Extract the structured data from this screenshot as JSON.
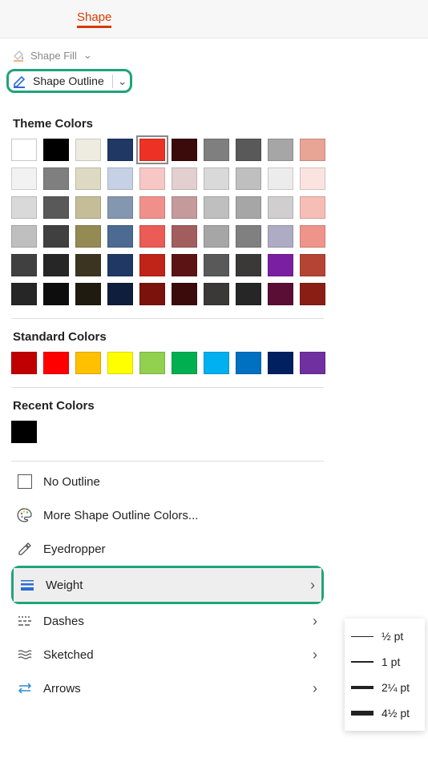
{
  "ribbon": {
    "active_tab": "Shape"
  },
  "toolbar": {
    "shape_fill": "Shape Fill",
    "shape_outline": "Shape Outline"
  },
  "sections": {
    "theme": "Theme Colors",
    "standard": "Standard Colors",
    "recent": "Recent Colors"
  },
  "theme_colors": {
    "row0": [
      "#ffffff",
      "#000000",
      "#eeece1",
      "#1f3864",
      "#ed3225",
      "#3b0a0b",
      "#7f7f7f",
      "#595959",
      "#a6a6a6",
      "#e8a494"
    ],
    "row1": [
      "#f2f2f2",
      "#7f7f7f",
      "#ddd9c3",
      "#c7d1e6",
      "#f6c7c4",
      "#e3cfd0",
      "#d9d9d9",
      "#bfbfbf",
      "#ececec",
      "#fbe3df"
    ],
    "row2": [
      "#d9d9d9",
      "#595959",
      "#c4bd97",
      "#8497b0",
      "#f1908b",
      "#c59a9a",
      "#bfbfbf",
      "#a6a6a6",
      "#d0cece",
      "#f6beb6"
    ],
    "row3": [
      "#bfbfbf",
      "#404040",
      "#948a54",
      "#4c6a92",
      "#ea5c55",
      "#a25e5e",
      "#a6a6a6",
      "#808080",
      "#aeabc4",
      "#ef948b"
    ],
    "row4": [
      "#404040",
      "#262626",
      "#3a3421",
      "#203864",
      "#c02418",
      "#5c1314",
      "#595959",
      "#3b3838",
      "#7b1fa2",
      "#b54434"
    ],
    "row5": [
      "#262626",
      "#0d0d0d",
      "#1f1b10",
      "#0f1e3c",
      "#7b120c",
      "#3b0a0b",
      "#3b3838",
      "#262626",
      "#5a0e35",
      "#8a1e15"
    ]
  },
  "theme_selected": {
    "row": 0,
    "col": 4
  },
  "standard_colors": [
    "#c00000",
    "#ff0000",
    "#ffc000",
    "#ffff00",
    "#92d050",
    "#00b050",
    "#00b0f0",
    "#0070c0",
    "#002060",
    "#7030a0"
  ],
  "recent_colors": [
    "#000000"
  ],
  "menu": {
    "no_outline": "No Outline",
    "more_colors": "More Shape Outline Colors...",
    "eyedropper": "Eyedropper",
    "weight": "Weight",
    "dashes": "Dashes",
    "sketched": "Sketched",
    "arrows": "Arrows"
  },
  "weight_options": [
    {
      "label": "½ pt",
      "px": 1
    },
    {
      "label": "1 pt",
      "px": 2
    },
    {
      "label": "2¼ pt",
      "px": 4
    },
    {
      "label": "4½ pt",
      "px": 6
    }
  ]
}
